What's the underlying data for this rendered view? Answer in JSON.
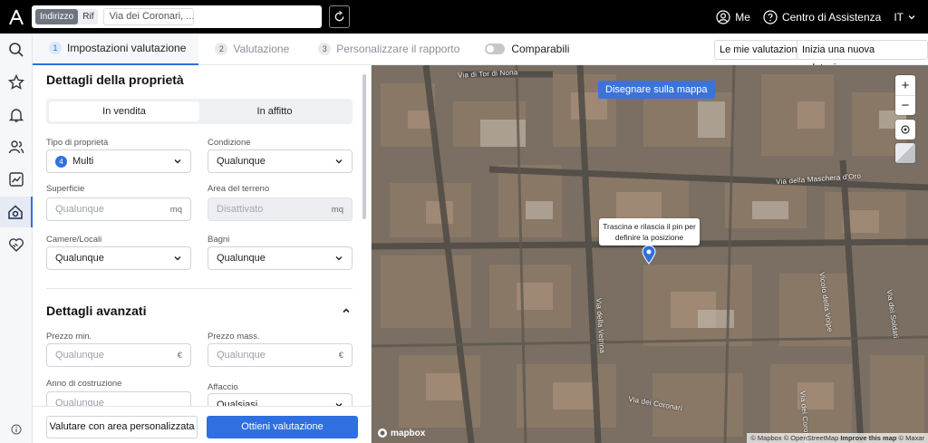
{
  "topbar": {
    "search_segment": [
      "Indirizzo",
      "Rif"
    ],
    "search_value": "Via dei Coronari, ...",
    "me_label": "Me",
    "help_label": "Centro di Assistenza",
    "language": "IT"
  },
  "tabs": {
    "steps": [
      {
        "num": "1",
        "label": "Impostazioni valutazione"
      },
      {
        "num": "2",
        "label": "Valutazione"
      },
      {
        "num": "3",
        "label": "Personalizzare il rapporto"
      }
    ],
    "comparabili_label": "Comparabili",
    "my_valuations": "Le mie valutazioni",
    "new_valuation": "Inizia una nuova valutazione"
  },
  "form": {
    "property_details_title": "Dettagli della proprietà",
    "listing_options": [
      "In vendita",
      "In affitto"
    ],
    "property_type": {
      "label": "Tipo di proprietà",
      "count": "4",
      "value": "Multi"
    },
    "condition": {
      "label": "Condizione",
      "value": "Qualunque"
    },
    "surface": {
      "label": "Superficie",
      "placeholder": "Qualunque",
      "unit": "mq"
    },
    "land_area": {
      "label": "Area del terreno",
      "placeholder": "Disattivato",
      "unit": "mq"
    },
    "rooms": {
      "label": "Camere/Locali",
      "value": "Qualunque"
    },
    "bathrooms": {
      "label": "Bagni",
      "value": "Qualunque"
    },
    "advanced_title": "Dettagli avanzati",
    "price_min": {
      "label": "Prezzo min.",
      "placeholder": "Qualunque",
      "unit": "€"
    },
    "price_max": {
      "label": "Prezzo mass.",
      "placeholder": "Qualunque",
      "unit": "€"
    },
    "year_built": {
      "label": "Anno di costruzione",
      "placeholder": "Qualunque"
    },
    "view": {
      "label": "Affaccio",
      "value": "Qualsiasi"
    },
    "btn_custom_area": "Valutare con area personalizzata",
    "btn_get_valuation": "Ottieni valutazione"
  },
  "map": {
    "draw_button": "Disegnare sulla mappa",
    "pin_tooltip_line1": "Trascina e rilascia il pin per",
    "pin_tooltip_line2": "definire la posizione",
    "streets": [
      "Via di Tor di Nona",
      "Via della Maschera d'Oro",
      "Via della Vetrina",
      "Via dei Coronari",
      "Vicolo della Volpe",
      "Via dei Soldati",
      "Via dei Coronari"
    ],
    "attribution": "© Mapbox © OpenStreetMap",
    "improve_label": "Improve this map",
    "maxar": "© Maxar",
    "logo_text": "mapbox",
    "zoom_in": "+",
    "zoom_out": "−"
  },
  "colors": {
    "accent": "#2f6fe0",
    "topbar": "#000000",
    "map_button": "#3d73d8"
  }
}
